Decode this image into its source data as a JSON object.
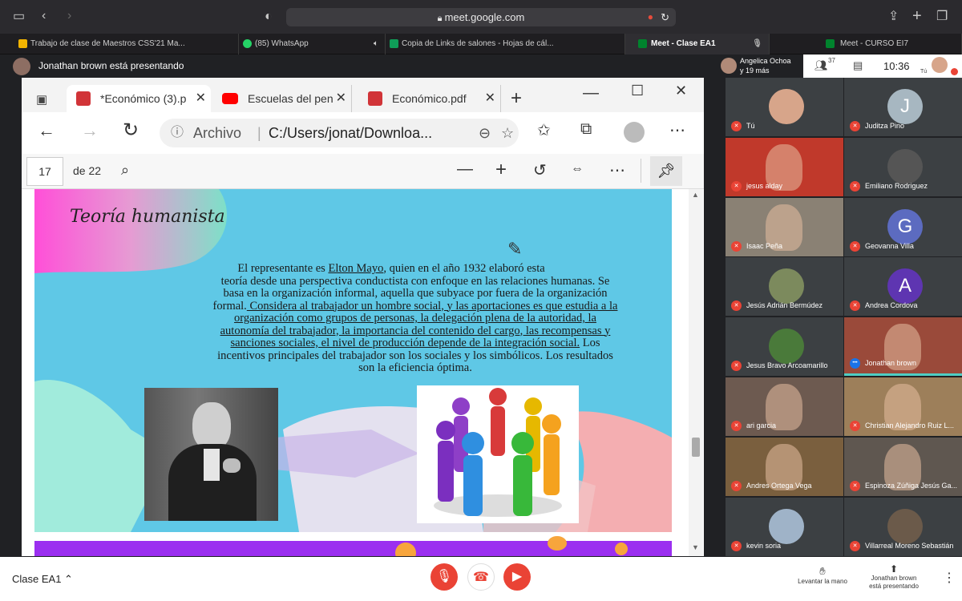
{
  "browser": {
    "url": "meet.google.com",
    "tabs": [
      {
        "label": "Trabajo de clase de Maestros CSS'21 Ma..."
      },
      {
        "label": "(85) WhatsApp"
      },
      {
        "label": "Copia de Links de salones - Hojas de cál..."
      },
      {
        "label": "Meet - Clase EA1"
      },
      {
        "label": "Meet - CURSO EI7"
      }
    ]
  },
  "meet": {
    "presenting_banner": "Jonathan brown está presentando",
    "top_right": {
      "participants_summary_line1": "Angelica Ochoa",
      "participants_summary_line2": "y 19 más",
      "people_count": "37",
      "time": "10:36",
      "self_label": "Tú"
    },
    "participants": [
      {
        "name": "Tú",
        "type": "photo",
        "color": "#d7a58a"
      },
      {
        "name": "Juditza Pino",
        "type": "letter",
        "letter": "J",
        "color": "#a7b7c1"
      },
      {
        "name": "jesus alday",
        "type": "video",
        "color": "#c0392b"
      },
      {
        "name": "Emiliano Rodriguez",
        "type": "photo",
        "color": "#555"
      },
      {
        "name": "Isaac Peña",
        "type": "video",
        "color": "#8a8174"
      },
      {
        "name": "Geovanna Villa",
        "type": "letter",
        "letter": "G",
        "color": "#5c6bc0"
      },
      {
        "name": "Jesús Adrián Bermúdez",
        "type": "photo",
        "color": "#7c8a5d"
      },
      {
        "name": "Andrea Cordova",
        "type": "letter",
        "letter": "A",
        "color": "#5e35b1"
      },
      {
        "name": "Jesus Bravo Arcoamarillo",
        "type": "photo",
        "color": "#4a7a3a"
      },
      {
        "name": "Jonathan brown",
        "type": "video",
        "color": "#9a4a3a",
        "speaking": true
      },
      {
        "name": "ari garcia",
        "type": "video",
        "color": "#6d5a50"
      },
      {
        "name": "Christian Alejandro Ruiz L...",
        "type": "video",
        "color": "#9d7f5a"
      },
      {
        "name": "Andres Ortega Vega",
        "type": "video",
        "color": "#7a5f3e"
      },
      {
        "name": "Espinoza Zúñiga Jesús Ga...",
        "type": "video",
        "color": "#5f5750"
      },
      {
        "name": "kevin soria",
        "type": "photo",
        "color": "#9fb3c8"
      },
      {
        "name": "Villarreal Moreno Sebastián",
        "type": "photo",
        "color": "#6b5a4a"
      }
    ],
    "bottom": {
      "meeting_name": "Clase EA1",
      "raise_hand": "Levantar la mano",
      "presenting_line1": "Jonathan brown",
      "presenting_line2": "está presentando"
    }
  },
  "edge": {
    "tabs": [
      {
        "label": "*Económico (3).p"
      },
      {
        "label": "Escuelas del pen"
      },
      {
        "label": "Económico.pdf"
      }
    ],
    "address_prefix": "Archivo",
    "address_path": "C:/Users/jonat/Downloa...",
    "pdf": {
      "current_page": "17",
      "total_pages": "de 22",
      "title": "Teoría humanista",
      "para1": "El representante es",
      "para1_link": "Elton Mayo",
      "para1_rest": ", quien en el año 1932 elaboró esta",
      "line2": "teoría desde una perspectiva conductista con enfoque en las relaciones humanas. Se",
      "line3": "basa en la organización informal, aquella que subyace por fuera de la organización",
      "line4_plain": "formal.",
      "line4_ul": " Considera al trabajador un hombre social, y las aportaciones es que estudia a la",
      "line5": "organización como grupos de personas, la delegación plena de la autoridad, la",
      "line6": "autonomía del trabajador, la importancia del contenido del cargo, las recompensas y",
      "line7_ul": "sanciones sociales, el nivel de producción depende de la integración social.",
      "line7_plain": " Los",
      "line8": "incentivos principales del trabajador son los sociales y los simbólicos. Los resultados",
      "line9": "son la eficiencia óptima."
    }
  }
}
